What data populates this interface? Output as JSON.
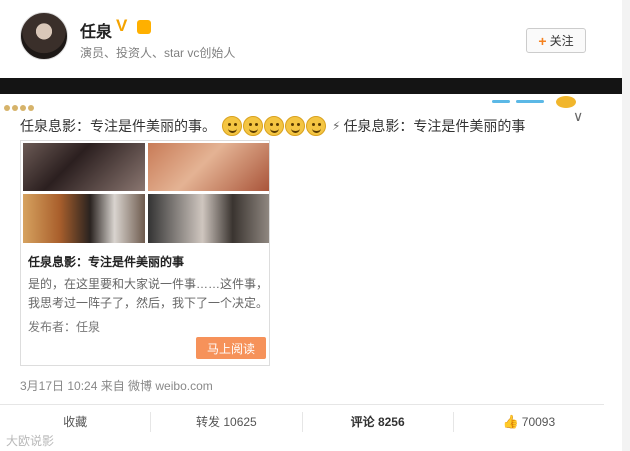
{
  "profile": {
    "name": "任泉",
    "verified_icon": "v-icon",
    "level_icon": "vip-icon",
    "level_label": "ぶ",
    "description": "演员、投资人、star vc创始人",
    "follow_label": "关注"
  },
  "post": {
    "text_prefix": "任泉息影：专注是件美丽的事。",
    "emoji_count_label": "smile-emoji x5",
    "text_suffix": "任泉息影：专注是件美丽的事",
    "card": {
      "title": "任泉息影：专注是件美丽的事",
      "desc_line1": "是的，在这里要和大家说一件事……这件事，",
      "desc_line2": "我思考过一阵子了，然后，我下了一个决定。",
      "author": "发布者：任泉",
      "read_label": "马上阅读"
    },
    "meta": "3月17日 10:24 来自 微博 weibo.com"
  },
  "actions": {
    "collect": "收藏",
    "repost": "转发 10625",
    "comment": "评论 8256",
    "like": "70093"
  },
  "watermark": "大欧说影",
  "colors": {
    "accent": "#f58220",
    "read_button": "#f6925a",
    "black_bar": "#141414"
  }
}
